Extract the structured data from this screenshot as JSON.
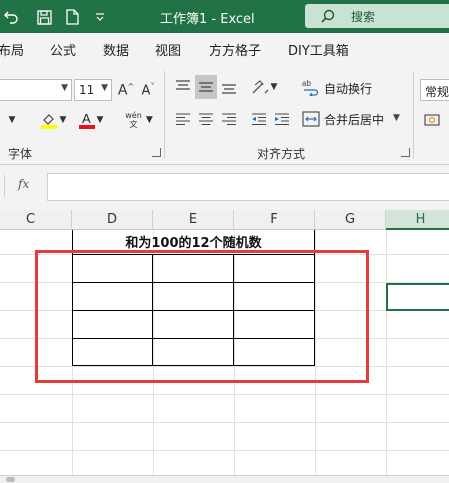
{
  "titlebar": {
    "title": "工作簿1  -  Excel",
    "search_label": "搜索",
    "bg": "#217346"
  },
  "tabs": [
    "布局",
    "公式",
    "数据",
    "视图",
    "方方格子",
    "DIY工具箱"
  ],
  "ribbon": {
    "font_name": "",
    "font_size": "11",
    "grow_font": "A^",
    "shrink_font": "A˅",
    "pinyin": "wén",
    "group_font": "字体",
    "wrap_text": "自动换行",
    "merge_center": "合并后居中",
    "group_alignment": "对齐方式",
    "number_format": "常规"
  },
  "formula_bar": {
    "fx": "fx",
    "value": ""
  },
  "columns": [
    "C",
    "D",
    "E",
    "F",
    "G",
    "H"
  ],
  "active_column": "H",
  "sheet": {
    "table_title": "和为100的12个随机数",
    "table_rows": [
      [
        "",
        "",
        ""
      ],
      [
        "",
        "",
        ""
      ],
      [
        "",
        "",
        ""
      ],
      [
        "",
        "",
        ""
      ]
    ]
  },
  "colors": {
    "accent": "#217346",
    "highlight_frame": "#e43b3b",
    "font_color": "#e81123",
    "fill_color": "#ffff00"
  }
}
